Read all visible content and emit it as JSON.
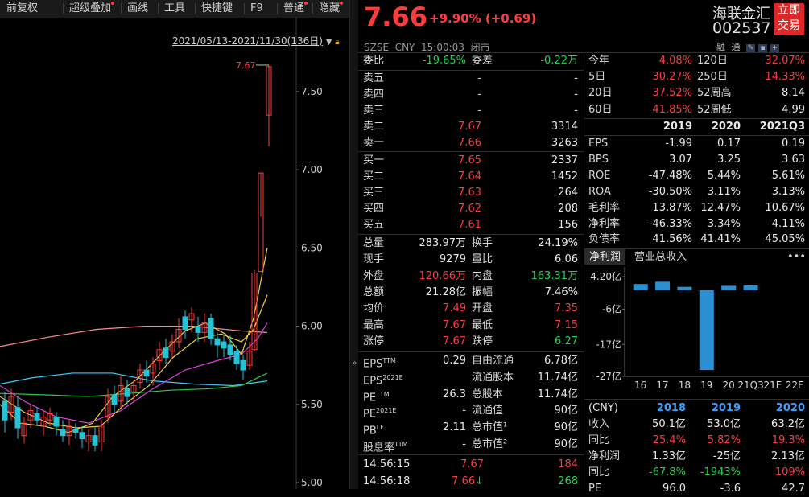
{
  "toolbar": {
    "items": [
      {
        "label": "前复权",
        "dot": false
      },
      {
        "label": "超级叠加",
        "dot": true
      },
      {
        "label": "画线",
        "dot": false
      },
      {
        "label": "工具",
        "dot": false
      },
      {
        "label": "快捷键",
        "dot": false
      },
      {
        "label": "F9",
        "dot": false
      },
      {
        "label": "普通",
        "dot": true
      },
      {
        "label": "隐藏",
        "dot": true
      }
    ]
  },
  "chart": {
    "date_range": "2021/05/13-2021/11/30(136日)",
    "high_label": "7.67",
    "y_ticks": [
      "7.50",
      "7.00",
      "6.50",
      "6.00",
      "5.50",
      "5.00"
    ],
    "colors": {
      "up": "#ff3b3b",
      "down": "#22c4d8",
      "ma5": "#e8e8e8",
      "ma10": "#f0d23c",
      "ma20": "#e040e0",
      "ma60": "#2ec84a",
      "ma120": "#40c8ff",
      "ma250": "#ff8c8c"
    }
  },
  "header": {
    "price": "7.66",
    "change": "+9.90% (+0.69)",
    "exchange": "SZSE",
    "currency": "CNY",
    "time": "15:00:03",
    "status": "闭市",
    "name": "海联金汇",
    "code": "002537",
    "trade_button": [
      "立即",
      "交易"
    ],
    "icons": [
      "融",
      "通"
    ]
  },
  "orderbook": {
    "weibi_label": "委比",
    "weibi": "-19.65%",
    "weicha_label": "委差",
    "weicha": "-0.22万",
    "asks": [
      {
        "label": "卖五",
        "price": "-",
        "vol": "-"
      },
      {
        "label": "卖四",
        "price": "-",
        "vol": "-"
      },
      {
        "label": "卖三",
        "price": "-",
        "vol": "-"
      },
      {
        "label": "卖二",
        "price": "7.67",
        "vol": "3314"
      },
      {
        "label": "卖一",
        "price": "7.66",
        "vol": "3263"
      }
    ],
    "bids": [
      {
        "label": "买一",
        "price": "7.65",
        "vol": "2337"
      },
      {
        "label": "买二",
        "price": "7.64",
        "vol": "1452"
      },
      {
        "label": "买三",
        "price": "7.63",
        "vol": "264"
      },
      {
        "label": "买四",
        "price": "7.62",
        "vol": "208"
      },
      {
        "label": "买五",
        "price": "7.61",
        "vol": "156"
      }
    ]
  },
  "stats": [
    {
      "l1": "总量",
      "v1": "283.97万",
      "c1": "white",
      "l2": "换手",
      "v2": "24.19%",
      "c2": "white"
    },
    {
      "l1": "现手",
      "v1": "9279",
      "c1": "white",
      "l2": "量比",
      "v2": "6.06",
      "c2": "white"
    },
    {
      "l1": "外盘",
      "v1": "120.66万",
      "c1": "red",
      "l2": "内盘",
      "v2": "163.31万",
      "c2": "green"
    },
    {
      "l1": "总额",
      "v1": "21.28亿",
      "c1": "white",
      "l2": "振幅",
      "v2": "7.46%",
      "c2": "white"
    },
    {
      "l1": "均价",
      "v1": "7.49",
      "c1": "red",
      "l2": "开盘",
      "v2": "7.35",
      "c2": "red"
    },
    {
      "l1": "最高",
      "v1": "7.67",
      "c1": "red",
      "l2": "最低",
      "v2": "7.15",
      "c2": "red"
    },
    {
      "l1": "涨停",
      "v1": "7.67",
      "c1": "red",
      "l2": "跌停",
      "v2": "6.27",
      "c2": "green"
    }
  ],
  "fundamentals": [
    {
      "l1": "EPS",
      "sup1": "TTM",
      "v1": "0.29",
      "l2": "自由流通",
      "v2": "6.78亿"
    },
    {
      "l1": "EPS",
      "sup1": "2021E",
      "v1": "",
      "l2": "流通股本",
      "v2": "11.74亿"
    },
    {
      "l1": "PE",
      "sup1": "TTM",
      "v1": "26.3",
      "l2": "总股本",
      "v2": "11.74亿"
    },
    {
      "l1": "PE",
      "sup1": "2021E",
      "v1": "-",
      "l2": "流通值",
      "v2": "90亿"
    },
    {
      "l1": "PB",
      "sup1": "LF",
      "v1": "2.11",
      "l2": "总市值¹",
      "v2": "90亿"
    },
    {
      "l1": "股息率",
      "sup1": "TTM",
      "v1": "-",
      "l2": "总市值²",
      "v2": "90亿"
    }
  ],
  "ticks": [
    {
      "time": "14:56:15",
      "price": "7.67",
      "vol": "184",
      "arrow": "",
      "vcolor": "red"
    },
    {
      "time": "14:56:18",
      "price": "7.66",
      "vol": "268",
      "arrow": "↓",
      "vcolor": "green"
    }
  ],
  "perf": {
    "rows": [
      {
        "l1": "今年",
        "v1": "4.08%",
        "l2": "120日",
        "v2": "32.07%",
        "c2": "red"
      },
      {
        "l1": "5日",
        "v1": "30.27%",
        "l2": "250日",
        "v2": "14.33%",
        "c2": "red"
      },
      {
        "l1": "20日",
        "v1": "37.52%",
        "l2": "52周高",
        "v2": "8.14",
        "c2": "white"
      },
      {
        "l1": "60日",
        "v1": "41.85%",
        "l2": "52周低",
        "v2": "4.99",
        "c2": "white"
      }
    ]
  },
  "ratios": {
    "years": [
      "2019",
      "2020",
      "2021Q3"
    ],
    "rows": [
      {
        "label": "EPS",
        "vals": [
          "-1.99",
          "0.17",
          "0.19"
        ]
      },
      {
        "label": "BPS",
        "vals": [
          "3.07",
          "3.25",
          "3.63"
        ]
      },
      {
        "label": "ROE",
        "vals": [
          "-47.48%",
          "5.44%",
          "5.61%"
        ]
      },
      {
        "label": "ROA",
        "vals": [
          "-30.50%",
          "3.11%",
          "3.13%"
        ]
      },
      {
        "label": "毛利率",
        "vals": [
          "13.87%",
          "12.47%",
          "10.67%"
        ]
      },
      {
        "label": "净利率",
        "vals": [
          "-46.33%",
          "3.34%",
          "4.11%"
        ]
      },
      {
        "label": "负债率",
        "vals": [
          "41.56%",
          "41.41%",
          "45.05%"
        ]
      }
    ]
  },
  "profit_tabs": {
    "active": "净利润",
    "other": "营业总收入",
    "more": "•••"
  },
  "chart_data": {
    "type": "bar",
    "categories": [
      "16",
      "17",
      "18",
      "19",
      "20",
      "21Q3",
      "21E",
      "22E"
    ],
    "values": [
      1.9,
      2.6,
      1.0,
      -25.0,
      1.33,
      1.5,
      null,
      null
    ],
    "y_ticks": [
      "4.20亿",
      "-6亿",
      "-17亿",
      "-27亿"
    ],
    "ylim": [
      -27,
      4.2
    ],
    "color": "#2a8fd4"
  },
  "annual": {
    "currency": "(CNY)",
    "years": [
      "2018",
      "2019",
      "2020"
    ],
    "rows": [
      {
        "label": "收入",
        "vals": [
          "50.1亿",
          "53.0亿",
          "63.2亿"
        ],
        "colors": [
          "white",
          "white",
          "white"
        ]
      },
      {
        "label": "同比",
        "vals": [
          "25.4%",
          "5.82%",
          "19.3%"
        ],
        "colors": [
          "red",
          "red",
          "red"
        ]
      },
      {
        "label": "净利润",
        "vals": [
          "1.33亿",
          "-25亿",
          "2.13亿"
        ],
        "colors": [
          "white",
          "white",
          "white"
        ]
      },
      {
        "label": "同比",
        "vals": [
          "-67.8%",
          "-1943%",
          "109%"
        ],
        "colors": [
          "green",
          "green",
          "red"
        ]
      },
      {
        "label": "PE",
        "vals": [
          "96.0",
          "-3.6",
          "42.7"
        ],
        "colors": [
          "white",
          "white",
          "white"
        ]
      }
    ]
  }
}
